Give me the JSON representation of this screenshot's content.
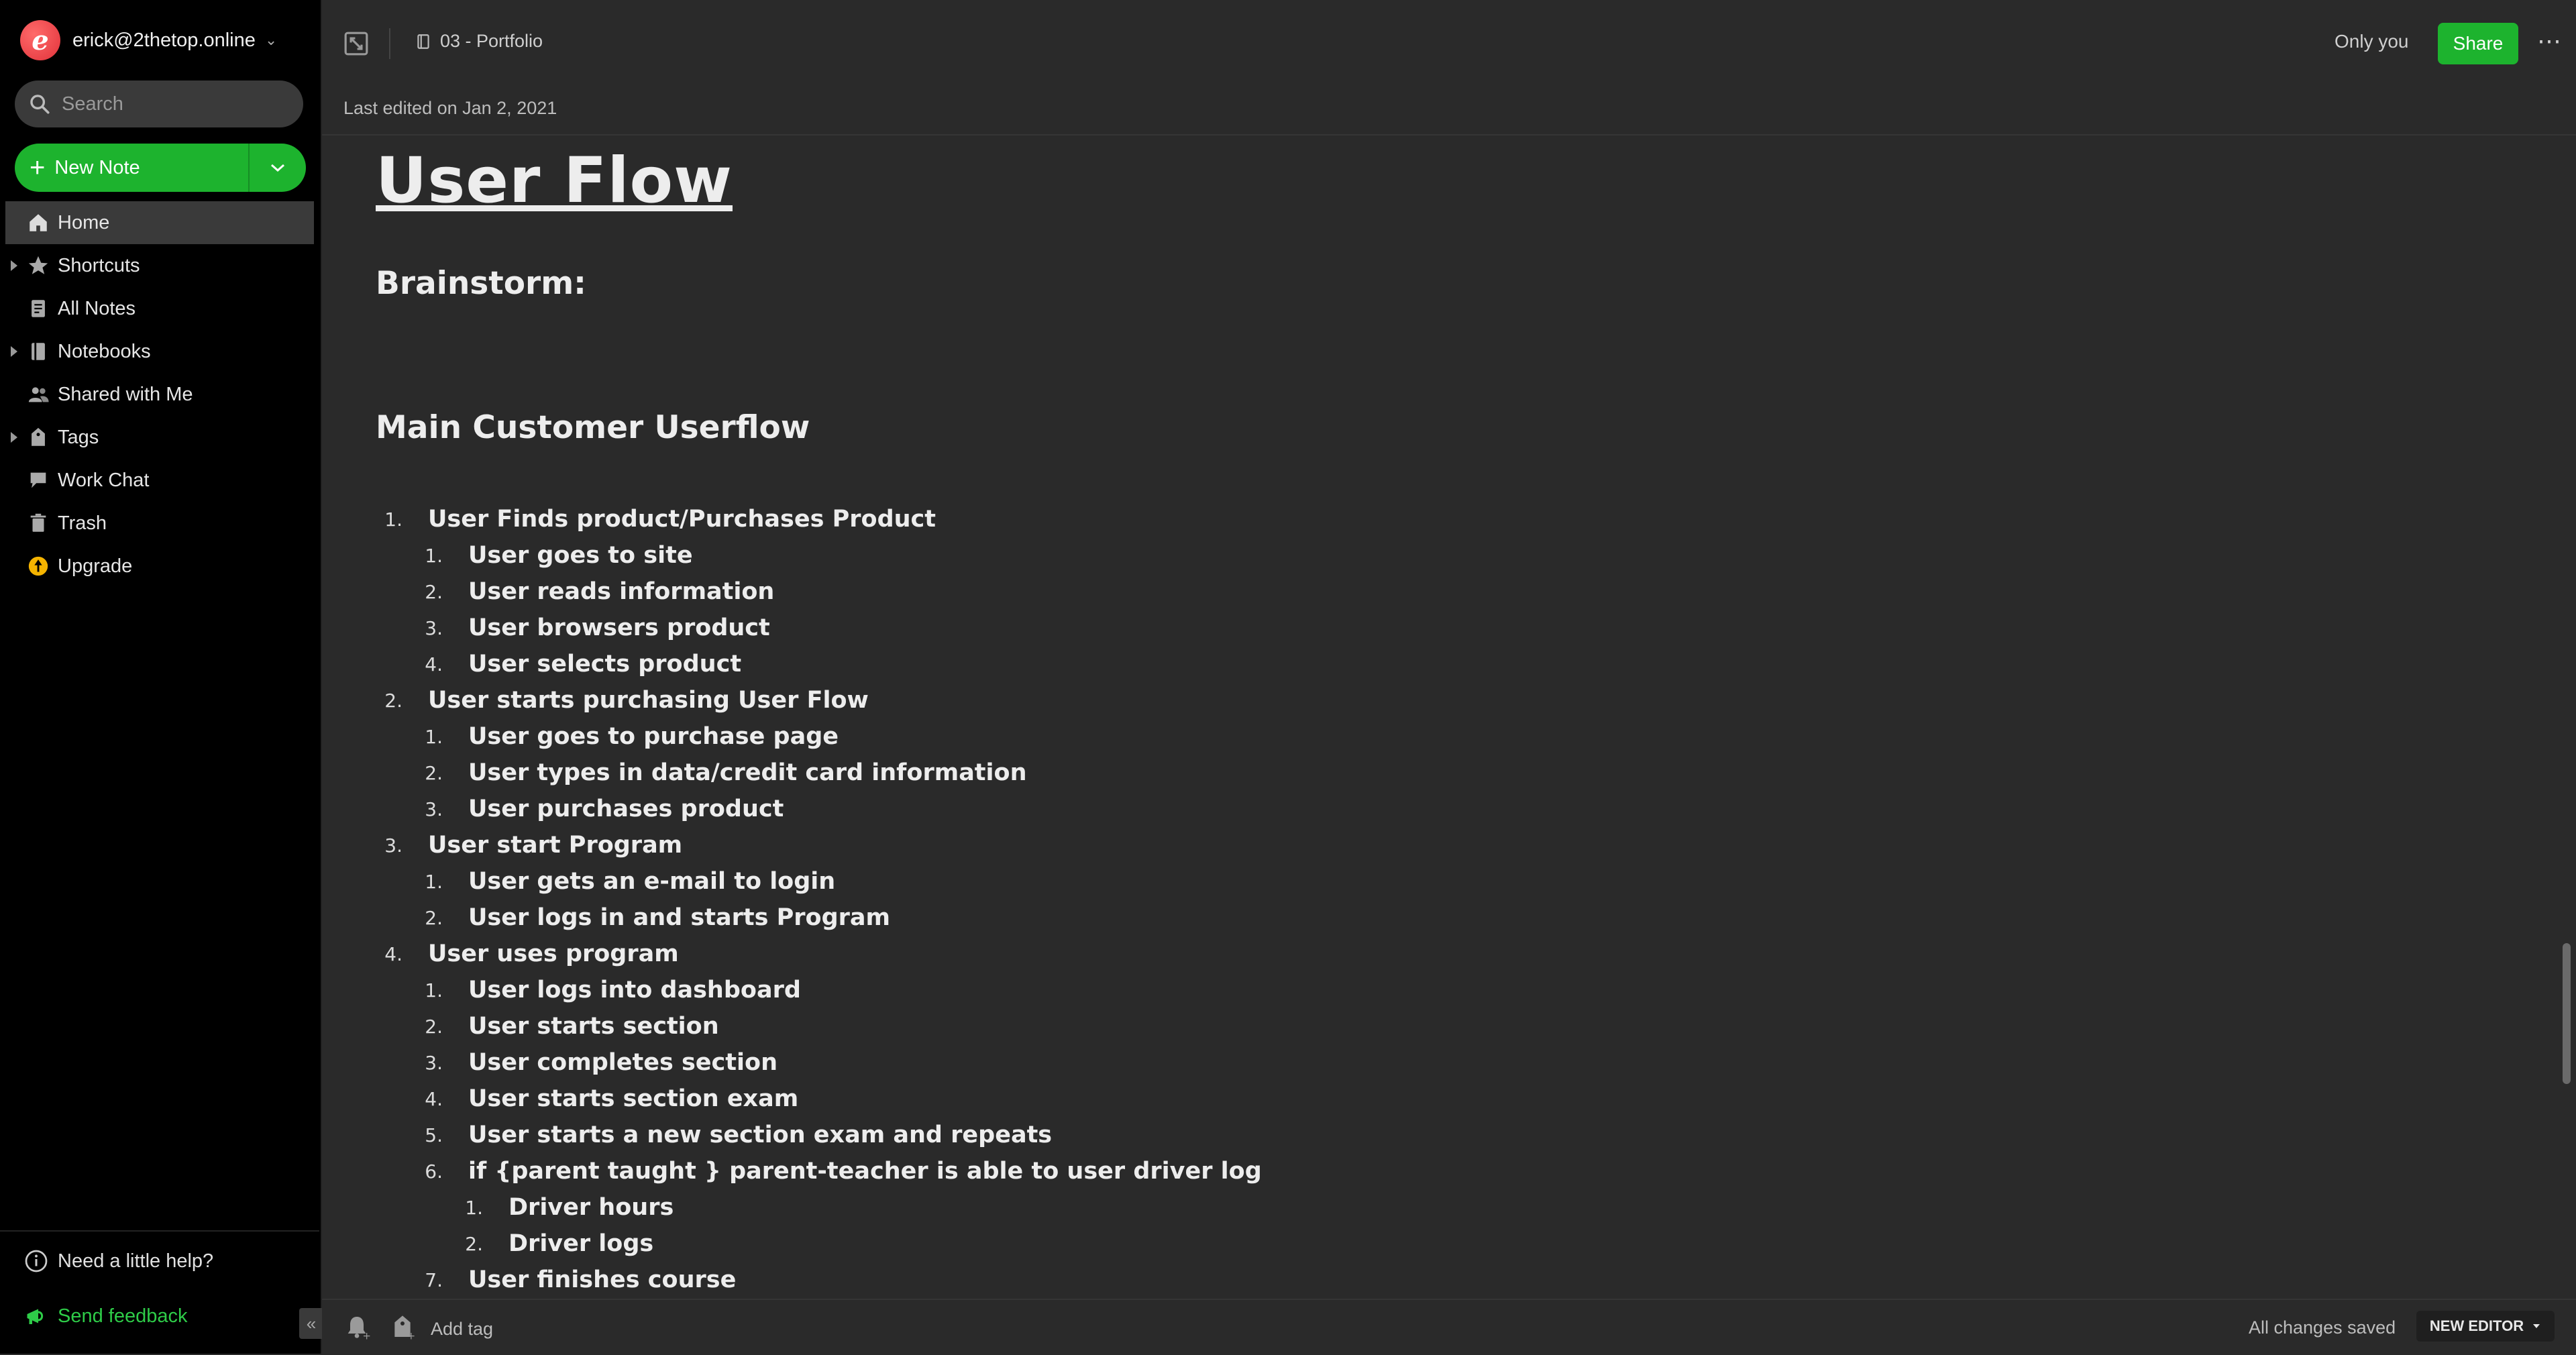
{
  "account": {
    "email": "erick@2thetop.online",
    "logo_letter": "e"
  },
  "search": {
    "placeholder": "Search"
  },
  "new_note": {
    "label": "New Note"
  },
  "nav": {
    "home": "Home",
    "shortcuts": "Shortcuts",
    "all_notes": "All Notes",
    "notebooks": "Notebooks",
    "shared": "Shared with Me",
    "tags": "Tags",
    "work_chat": "Work Chat",
    "trash": "Trash",
    "upgrade": "Upgrade"
  },
  "footer": {
    "help": "Need a little help?",
    "feedback": "Send feedback"
  },
  "topbar": {
    "notebook": "03 - Portfolio",
    "last_edited": "Last edited on Jan 2, 2021",
    "visibility": "Only you",
    "share": "Share",
    "more": "⋯"
  },
  "note": {
    "title": "User Flow",
    "heading_brainstorm": "Brainstorm:",
    "heading_main": "Main Customer Userflow",
    "items": [
      {
        "level": 1,
        "num": "1.",
        "text": "User Finds product/Purchases Product"
      },
      {
        "level": 2,
        "num": "1.",
        "text": "User goes to site"
      },
      {
        "level": 2,
        "num": "2.",
        "text": "User reads information"
      },
      {
        "level": 2,
        "num": "3.",
        "text": "User browsers product"
      },
      {
        "level": 2,
        "num": "4.",
        "text": "User selects product"
      },
      {
        "level": 1,
        "num": "2.",
        "text": "User starts purchasing User Flow"
      },
      {
        "level": 2,
        "num": "1.",
        "text": "User goes to purchase page"
      },
      {
        "level": 2,
        "num": "2.",
        "text": "User types in data/credit card information"
      },
      {
        "level": 2,
        "num": "3.",
        "text": "User purchases product"
      },
      {
        "level": 1,
        "num": "3.",
        "text": "User start Program"
      },
      {
        "level": 2,
        "num": "1.",
        "text": "User gets an e-mail to login"
      },
      {
        "level": 2,
        "num": "2.",
        "text": "User logs in and starts Program"
      },
      {
        "level": 1,
        "num": "4.",
        "text": "User uses program"
      },
      {
        "level": 2,
        "num": "1.",
        "text": "User logs into dashboard"
      },
      {
        "level": 2,
        "num": "2.",
        "text": "User starts section"
      },
      {
        "level": 2,
        "num": "3.",
        "text": "User completes section"
      },
      {
        "level": 2,
        "num": "4.",
        "text": "User starts section exam"
      },
      {
        "level": 2,
        "num": "5.",
        "text": "User starts a new section exam and repeats"
      },
      {
        "level": 2,
        "num": "6.",
        "text": "if {parent taught } parent-teacher is able to user driver log"
      },
      {
        "level": 3,
        "num": "1.",
        "text": "Driver hours"
      },
      {
        "level": 3,
        "num": "2.",
        "text": "Driver logs"
      },
      {
        "level": 2,
        "num": "7.",
        "text": "User finishes course"
      }
    ]
  },
  "bottombar": {
    "add_tag": "Add tag",
    "saved": "All changes saved",
    "editor_label": "NEW EDITOR"
  },
  "colors": {
    "accent": "#1db32e",
    "sidebar_bg": "#000000",
    "main_bg": "#2a2a2a"
  }
}
